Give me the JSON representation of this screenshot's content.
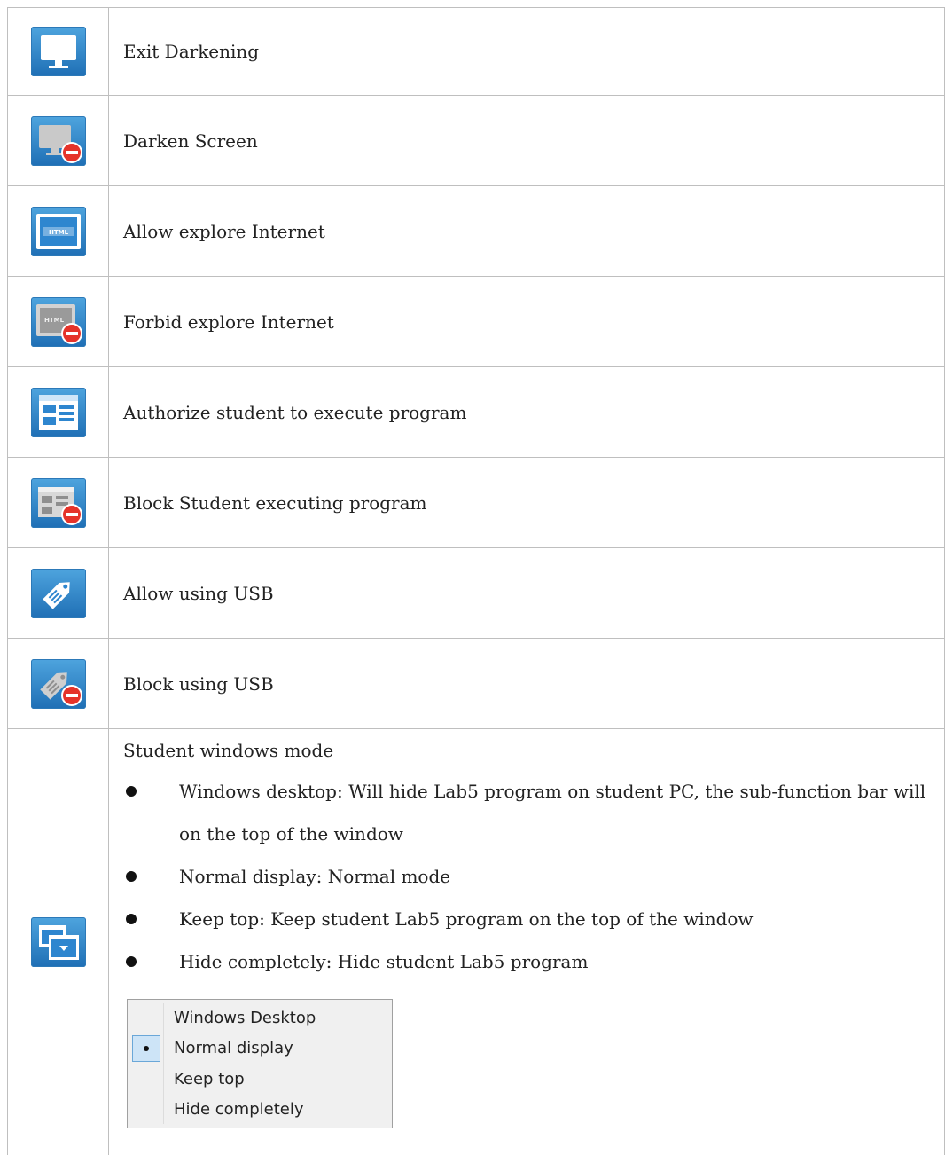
{
  "rows": [
    {
      "icon": "monitor-icon",
      "label": "Exit Darkening"
    },
    {
      "icon": "monitor-blocked-icon",
      "label": "Darken Screen"
    },
    {
      "icon": "html-icon",
      "label": "Allow explore Internet"
    },
    {
      "icon": "html-blocked-icon",
      "label": "Forbid explore Internet"
    },
    {
      "icon": "program-window-icon",
      "label": "Authorize student to execute program"
    },
    {
      "icon": "program-window-blocked-icon",
      "label": "Block Student executing program"
    },
    {
      "icon": "usb-tag-icon",
      "label": "Allow using USB"
    },
    {
      "icon": "usb-tag-blocked-icon",
      "label": "Block using USB"
    }
  ],
  "windows_mode": {
    "icon": "stacked-windows-icon",
    "title": "Student windows mode",
    "bullets": [
      "Windows desktop: Will hide Lab5 program on student PC, the sub-function bar will",
      "on the top of the window",
      "Normal display: Normal mode",
      "Keep top: Keep student Lab5 program on the top of the window",
      "Hide completely: Hide student Lab5 program"
    ],
    "menu": {
      "items": [
        "Windows Desktop",
        "Normal display",
        "Keep top",
        "Hide completely"
      ],
      "selected": "Normal display"
    }
  },
  "colors": {
    "icon_blue": "#2e86cf",
    "block_red": "#e5332a",
    "border": "#bfbfbf"
  }
}
